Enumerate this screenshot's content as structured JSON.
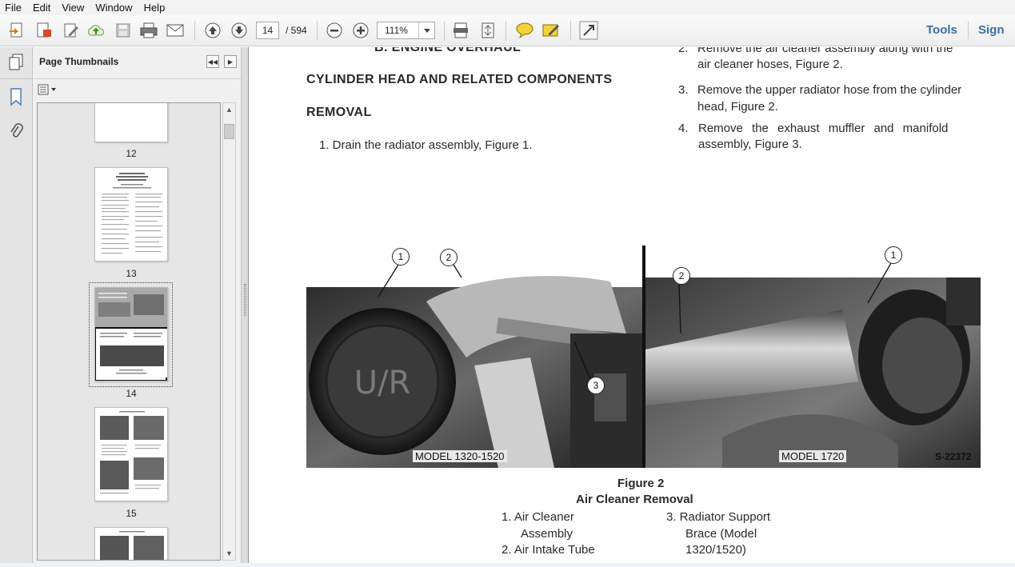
{
  "menu": [
    "File",
    "Edit",
    "View",
    "Window",
    "Help"
  ],
  "toolbar": {
    "current_page": "14",
    "page_total": "/ 594",
    "zoom": "111%",
    "tools_label": "Tools",
    "sign_label": "Sign"
  },
  "sidebar": {
    "title": "Page Thumbnails",
    "thumbnails": [
      {
        "label": "12"
      },
      {
        "label": "13"
      },
      {
        "label": "14"
      },
      {
        "label": "15"
      }
    ]
  },
  "document": {
    "section": "B.   ENGINE OVERHAUL",
    "heading": "CYLINDER HEAD AND RELATED COMPONENTS",
    "subheading": "REMOVAL",
    "step1": "1.  Drain the radiator assembly, Figure 1.",
    "step2_num": "2.",
    "step2_line1": "Remove the air cleaner assembly along with the",
    "step2_line2": "air cleaner hoses, Figure 2.",
    "step3_num": "3.",
    "step3_line1": "Remove the upper radiator hose from the cylinder",
    "step3_line2": "head, Figure 2.",
    "step4_num": "4.",
    "step4_line1": "Remove the exhaust muffler and manifold",
    "step4_line2": "assembly, Figure 3.",
    "figure": {
      "left_model": "MODEL 1320-1520",
      "right_model": "MODEL 1720",
      "code": "S-22372",
      "callouts_left": [
        "1",
        "2",
        "3"
      ],
      "callouts_right": [
        "1",
        "2"
      ],
      "left_emblem": "U/R",
      "caption_title": "Figure 2",
      "caption_subtitle": "Air Cleaner Removal",
      "legend": {
        "item1_line1": "1.  Air Cleaner",
        "item1_line2": "Assembly",
        "item2": "2.  Air Intake Tube",
        "item3_line1": "3.  Radiator Support",
        "item3_line2": "Brace (Model",
        "item3_line3": "1320/1520)"
      }
    }
  }
}
